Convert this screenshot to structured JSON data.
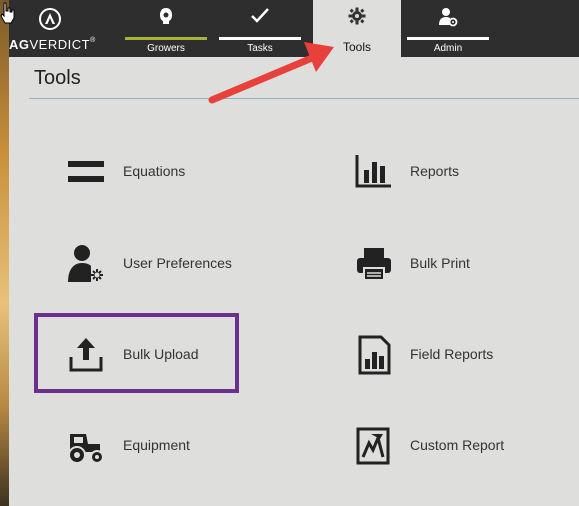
{
  "brand": {
    "logo_bold": "AG",
    "logo_rest": "VERDICT",
    "logo_mark": "®"
  },
  "nav": {
    "growers": "Growers",
    "tasks": "Tasks",
    "tools": "Tools",
    "admin": "Admin"
  },
  "page": {
    "title": "Tools"
  },
  "tools": {
    "equations": "Equations",
    "reports": "Reports",
    "user_preferences": "User Preferences",
    "bulk_print": "Bulk Print",
    "bulk_upload": "Bulk Upload",
    "field_reports": "Field Reports",
    "equipment": "Equipment",
    "custom_report": "Custom Report"
  },
  "colors": {
    "nav_bg": "#2e2e2e",
    "active_tab_bg": "#dedfdd",
    "growers_underline": "#a9b53a",
    "highlight_box": "#6b2f8e",
    "annotation_arrow": "#e8413c"
  },
  "icons": {
    "growers": "grower-head-icon",
    "tasks": "checkmark-icon",
    "tools": "gear-icon",
    "admin": "admin-user-gear-icon",
    "equations": "equals-icon",
    "reports": "bar-chart-icon",
    "user_preferences": "user-gear-icon",
    "bulk_print": "printer-icon",
    "bulk_upload": "upload-icon",
    "field_reports": "report-chart-icon",
    "equipment": "tractor-icon",
    "custom_report": "custom-report-icon"
  }
}
